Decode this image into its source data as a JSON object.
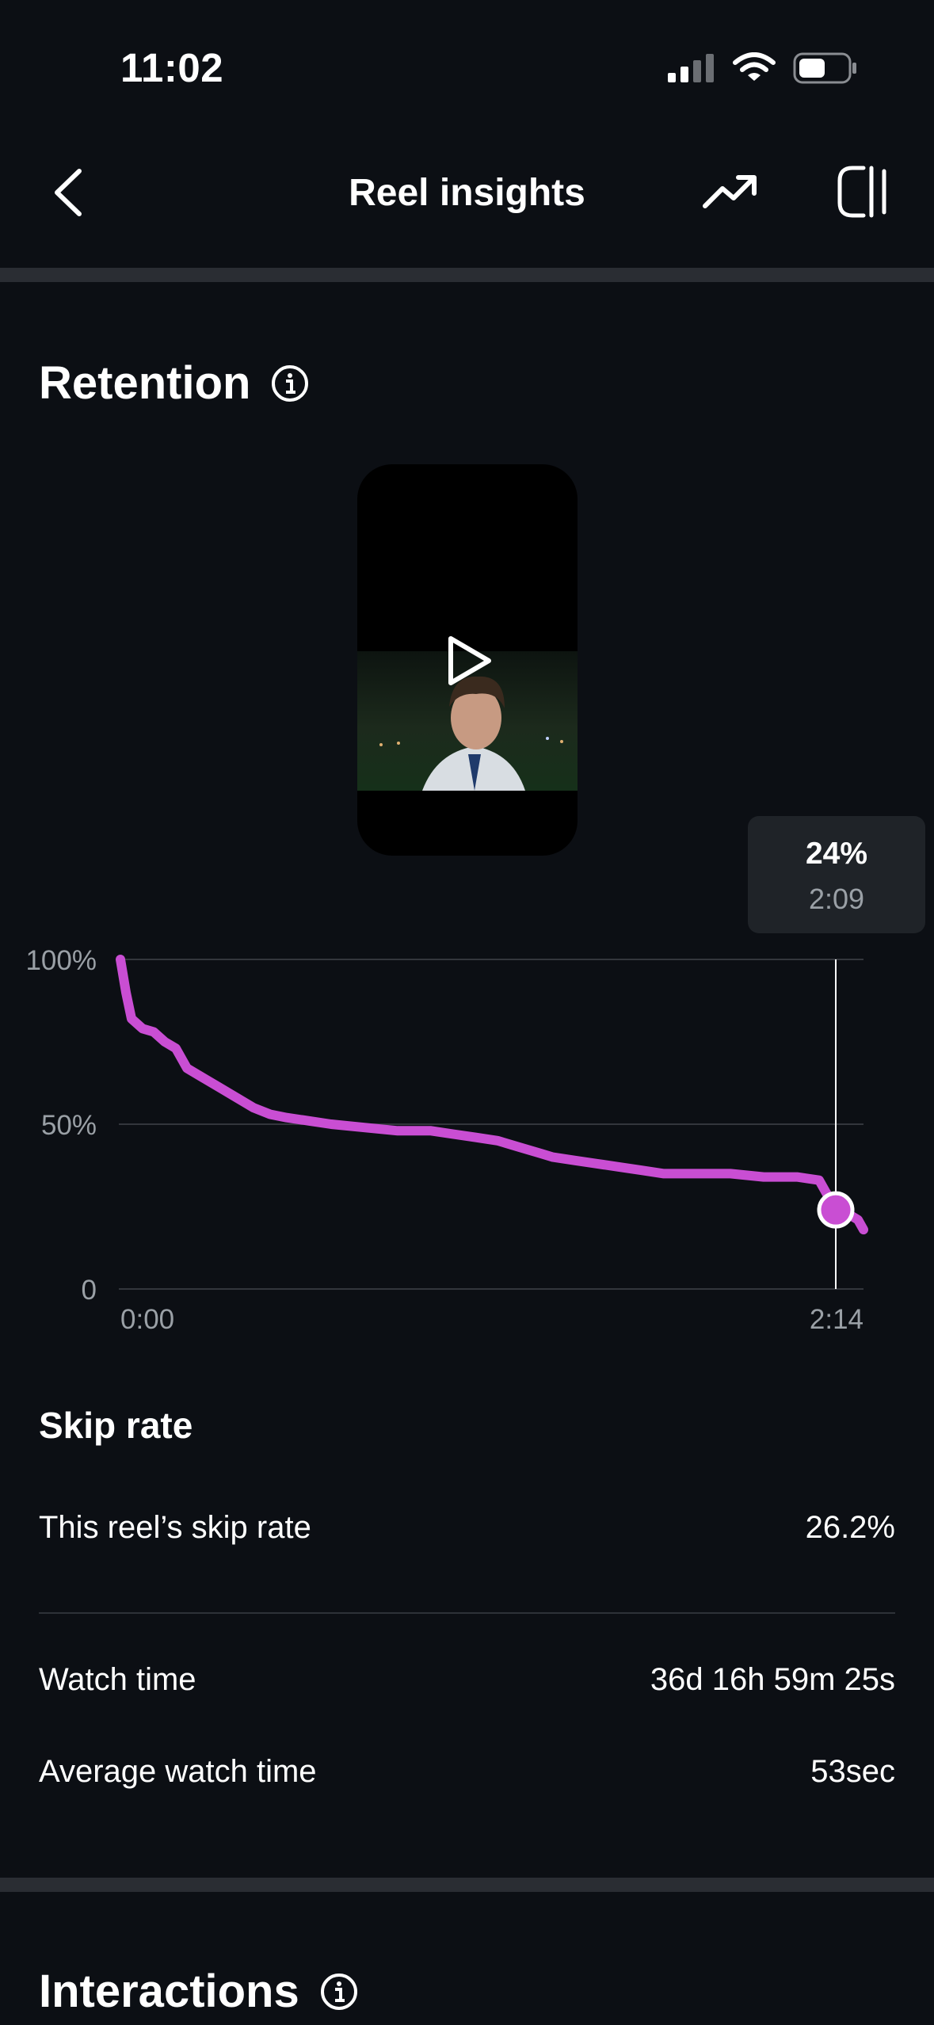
{
  "status_bar": {
    "time": "11:02",
    "icons": [
      "signal-icon",
      "wifi-icon",
      "battery-icon"
    ]
  },
  "nav": {
    "title": "Reel insights",
    "icons": [
      "back-chevron-icon",
      "trending-up-icon",
      "sidebar-toggle-icon"
    ]
  },
  "retention": {
    "title": "Retention",
    "tooltip": {
      "percent": "24%",
      "time": "2:09"
    }
  },
  "chart_data": {
    "type": "line",
    "y_ticks": [
      "100%",
      "50%",
      "0"
    ],
    "x_ticks": [
      "0:00",
      "2:14"
    ],
    "ylim": [
      0,
      100
    ],
    "xlim_seconds": [
      0,
      134
    ],
    "marker": {
      "x_seconds": 129,
      "y_percent": 24
    },
    "series": [
      {
        "color": "#c94ed3",
        "x_seconds": [
          0,
          1,
          2,
          4,
          6,
          8,
          10,
          12,
          15,
          18,
          21,
          24,
          27,
          30,
          34,
          38,
          44,
          50,
          56,
          60,
          64,
          68,
          72,
          76,
          78,
          82,
          86,
          90,
          94,
          98,
          104,
          110,
          116,
          122,
          126,
          129,
          131,
          133,
          134
        ],
        "y_percent": [
          100,
          90,
          82,
          79,
          78,
          75,
          73,
          67,
          64,
          61,
          58,
          55,
          53,
          52,
          51,
          50,
          49,
          48,
          48,
          47,
          46,
          45,
          43,
          41,
          40,
          39,
          38,
          37,
          36,
          35,
          35,
          35,
          34,
          34,
          33,
          24,
          23,
          21,
          18
        ]
      }
    ],
    "colors": {
      "line": "#c94ed3",
      "grid": "#33363c",
      "axis_label": "#9aa0a6"
    }
  },
  "skip_rate": {
    "title": "Skip rate",
    "this_reel_label": "This reel’s skip rate",
    "this_reel_value": "26.2%"
  },
  "watch": {
    "watch_time_label": "Watch time",
    "watch_time_value": "36d 16h 59m 25s",
    "avg_label": "Average watch time",
    "avg_value": "53sec"
  },
  "interactions": {
    "title": "Interactions"
  }
}
